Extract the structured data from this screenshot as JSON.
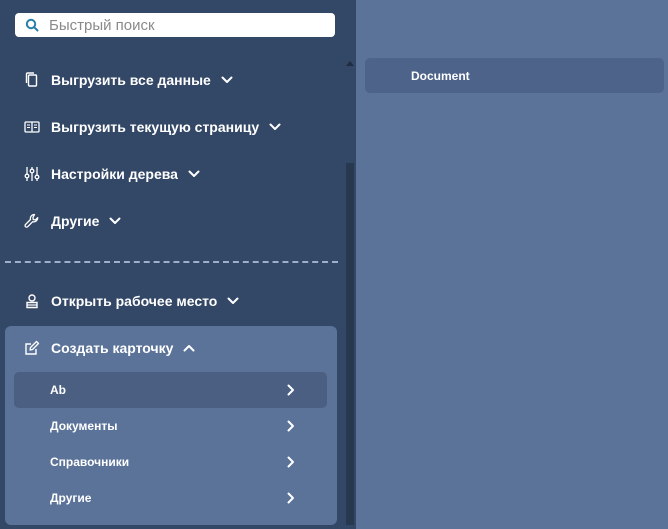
{
  "search": {
    "placeholder": "Быстрый поиск"
  },
  "menu": {
    "export_all": "Выгрузить все данные",
    "export_page": "Выгрузить текущую страницу",
    "tree_settings": "Настройки дерева",
    "other": "Другие",
    "open_workplace": "Открыть рабочее место",
    "create_card": "Создать карточку"
  },
  "create_card_items": [
    {
      "label": "Ab"
    },
    {
      "label": "Документы"
    },
    {
      "label": "Справочники"
    },
    {
      "label": "Другие"
    }
  ],
  "content": {
    "document_label": "Document"
  },
  "colors": {
    "sidebar_bg": "#334766",
    "content_bg": "#5b7399",
    "active_item": "#4a5f82",
    "search_icon": "#2a7fa8"
  },
  "icons": {
    "search": "search-icon",
    "export_all": "document-stack-icon",
    "export_page": "open-book-icon",
    "tree_settings": "sliders-icon",
    "other": "wrench-icon",
    "open_workplace": "user-workplace-icon",
    "create_card": "edit-card-icon"
  }
}
